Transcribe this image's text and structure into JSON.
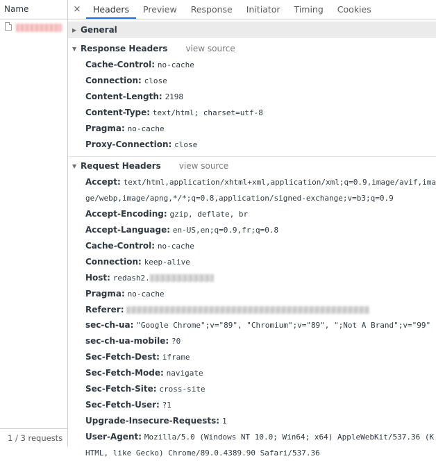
{
  "list": {
    "column_header": "Name",
    "footer": "1 / 3 requests"
  },
  "tabs": [
    {
      "label": "Headers",
      "active": true
    },
    {
      "label": "Preview"
    },
    {
      "label": "Response"
    },
    {
      "label": "Initiator"
    },
    {
      "label": "Timing"
    },
    {
      "label": "Cookies"
    }
  ],
  "icons": {
    "close": "×",
    "collapsed": "▶",
    "expanded": "▼"
  },
  "general": {
    "title": "General"
  },
  "response_headers": {
    "title": "Response Headers",
    "view_source": "view source",
    "items": [
      {
        "key": "Cache-Control:",
        "value": "no-cache"
      },
      {
        "key": "Connection:",
        "value": "close"
      },
      {
        "key": "Content-Length:",
        "value": "2198"
      },
      {
        "key": "Content-Type:",
        "value": "text/html; charset=utf-8"
      },
      {
        "key": "Pragma:",
        "value": "no-cache"
      },
      {
        "key": "Proxy-Connection:",
        "value": "close"
      }
    ]
  },
  "request_headers": {
    "title": "Request Headers",
    "view_source": "view source",
    "accept": {
      "key": "Accept:",
      "value": "text/html,application/xhtml+xml,application/xml;q=0.9,image/avif,image/webp,image/apng,*/*;q=0.8,application/signed-exchange;v=b3;q=0.9"
    },
    "accept_encoding": {
      "key": "Accept-Encoding:",
      "value": "gzip, deflate, br"
    },
    "accept_language": {
      "key": "Accept-Language:",
      "value": "en-US,en;q=0.9,fr;q=0.8"
    },
    "cache_control": {
      "key": "Cache-Control:",
      "value": "no-cache"
    },
    "connection": {
      "key": "Connection:",
      "value": "keep-alive"
    },
    "host": {
      "key": "Host:",
      "value": "redash2."
    },
    "pragma": {
      "key": "Pragma:",
      "value": "no-cache"
    },
    "referer": {
      "key": "Referer:"
    },
    "sec_ch_ua": {
      "key": "sec-ch-ua:",
      "value": "\"Google Chrome\";v=\"89\", \"Chromium\";v=\"89\", \";Not A Brand\";v=\"99\""
    },
    "sec_ch_ua_mobile": {
      "key": "sec-ch-ua-mobile:",
      "value": "?0"
    },
    "sec_fetch_dest": {
      "key": "Sec-Fetch-Dest:",
      "value": "iframe"
    },
    "sec_fetch_mode": {
      "key": "Sec-Fetch-Mode:",
      "value": "navigate"
    },
    "sec_fetch_site": {
      "key": "Sec-Fetch-Site:",
      "value": "cross-site"
    },
    "sec_fetch_user": {
      "key": "Sec-Fetch-User:",
      "value": "?1"
    },
    "upgrade_insecure": {
      "key": "Upgrade-Insecure-Requests:",
      "value": "1"
    },
    "user_agent": {
      "key": "User-Agent:",
      "value": "Mozilla/5.0 (Windows NT 10.0; Win64; x64) AppleWebKit/537.36 (KHTML, like Gecko) Chrome/89.0.4389.90 Safari/537.36"
    }
  }
}
